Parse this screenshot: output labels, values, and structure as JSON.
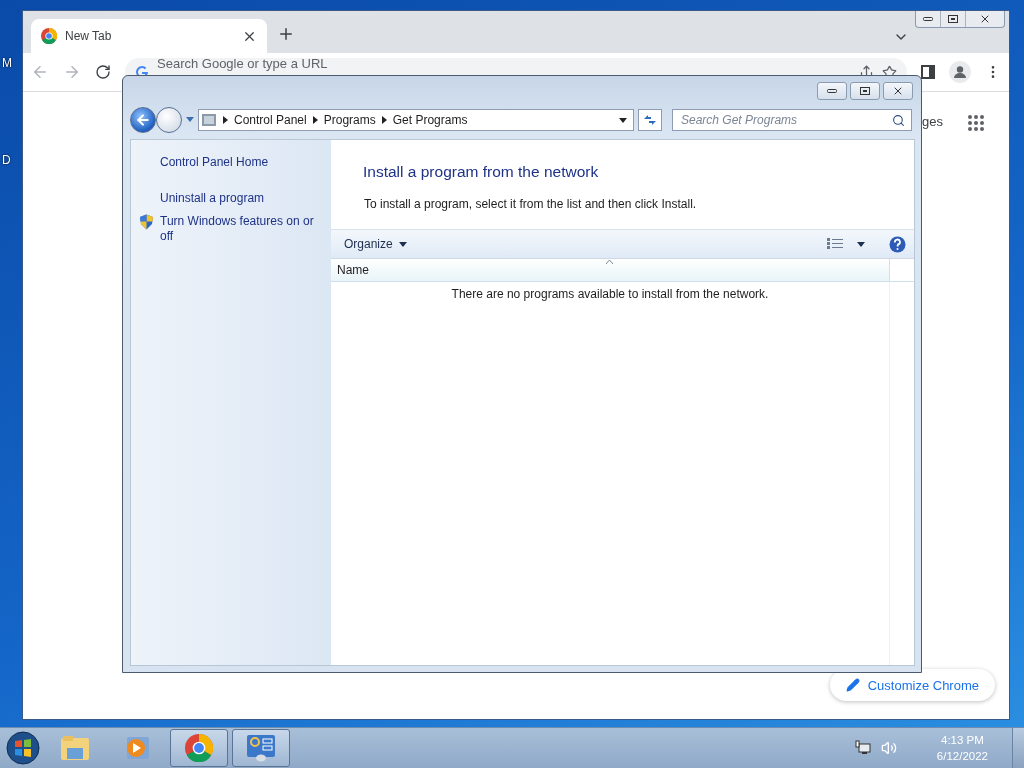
{
  "desktop": {
    "icon_labels": [
      "M",
      "D"
    ]
  },
  "browser": {
    "tabs": [
      {
        "title": "New Tab",
        "selected": true
      }
    ],
    "address_bar": {
      "placeholder": "Search Google or type a URL"
    },
    "page": {
      "partial_link": "ges",
      "customize_button": "Customize Chrome"
    }
  },
  "control_panel": {
    "breadcrumbs": [
      "Control Panel",
      "Programs",
      "Get Programs"
    ],
    "search": {
      "placeholder": "Search Get Programs"
    },
    "sidebar": {
      "links": [
        {
          "label": "Control Panel Home",
          "kind": "plain"
        },
        {
          "label": "Uninstall a program",
          "kind": "plain"
        },
        {
          "label": "Turn Windows features on or off",
          "kind": "shield"
        }
      ]
    },
    "heading": "Install a program from the network",
    "description": "To install a program, select it from the list and then click Install.",
    "toolbar": {
      "organize": "Organize"
    },
    "list": {
      "columns": [
        "Name"
      ],
      "empty_message": "There are no programs available to install from the network."
    }
  },
  "taskbar": {
    "apps": [
      {
        "kind": "explorer",
        "active": false
      },
      {
        "kind": "media",
        "active": false
      },
      {
        "kind": "chrome",
        "active": true
      },
      {
        "kind": "control_panel",
        "active": true
      }
    ],
    "clock": {
      "time": "4:13 PM",
      "date": "6/12/2022"
    }
  }
}
